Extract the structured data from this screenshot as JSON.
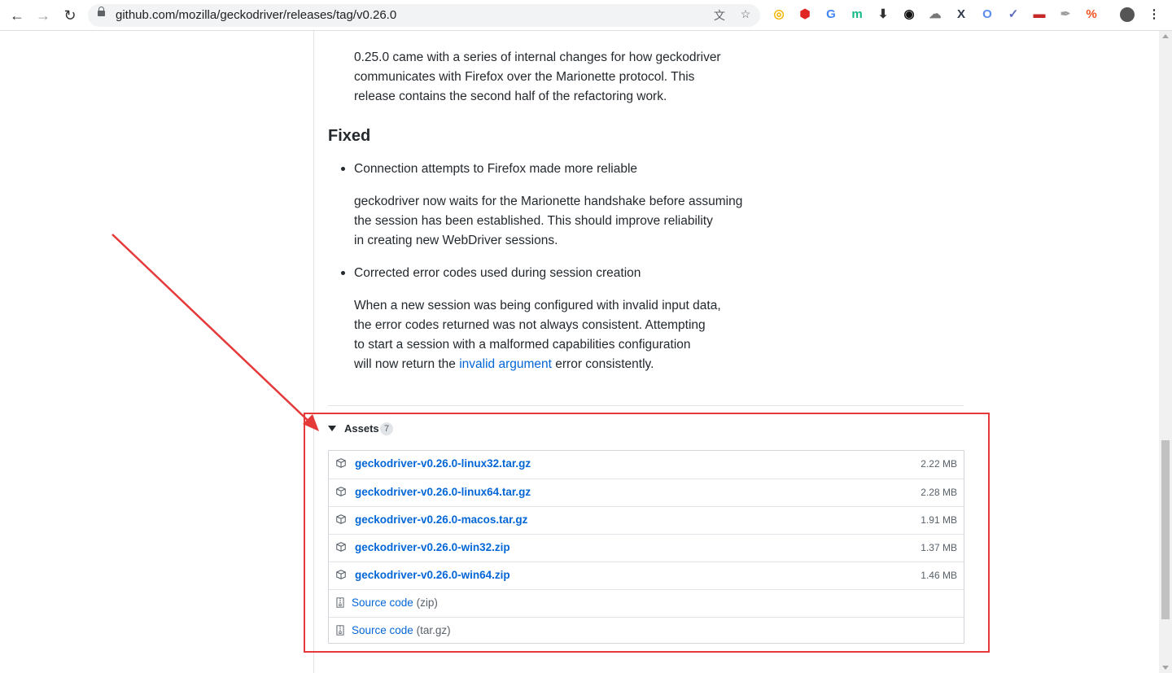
{
  "browser": {
    "url": "github.com/mozilla/geckodriver/releases/tag/v0.26.0",
    "extensions": [
      {
        "name": "chrome-ext-icon",
        "color": "#f4b400"
      },
      {
        "name": "adblock-icon",
        "color": "#e02424"
      },
      {
        "name": "google-translate-icon",
        "color": "#4285f4"
      },
      {
        "name": "m-ext-icon",
        "color": "#12b886"
      },
      {
        "name": "download-icon",
        "color": "#333333"
      },
      {
        "name": "eye-icon",
        "color": "#111111"
      },
      {
        "name": "cloud-icon",
        "color": "#777777"
      },
      {
        "name": "x-ext-icon",
        "color": "#2d3748"
      },
      {
        "name": "o-ext-icon",
        "color": "#5b8def"
      },
      {
        "name": "check-ext-icon",
        "color": "#5c6bc0"
      },
      {
        "name": "mask-ext-icon",
        "color": "#c62828"
      },
      {
        "name": "feather-ext-icon",
        "color": "#9e9e9e"
      },
      {
        "name": "percent-ext-icon",
        "color": "#f4511e"
      }
    ]
  },
  "content": {
    "para_refactor": [
      "0.25.0 came with a series of internal changes for how geckodriver",
      "communicates with Firefox over the Marionette protocol. This",
      "release contains the second half of the refactoring work."
    ],
    "fixed_heading": "Fixed",
    "fixed_items": [
      {
        "title": "Connection attempts to Firefox made more reliable",
        "body": [
          "geckodriver now waits for the Marionette handshake before assuming",
          "the session has been established. This should improve reliability",
          "in creating new WebDriver sessions."
        ]
      },
      {
        "title": "Corrected error codes used during session creation",
        "body": [
          "When a new session was being configured with invalid input data,",
          "the error codes returned was not always consistent. Attempting",
          "to start a session with a malformed capabilities configuration"
        ],
        "last_line_prefix": "will now return the ",
        "last_line_link": "invalid argument",
        "last_line_suffix": " error consistently."
      }
    ]
  },
  "assets": {
    "label": "Assets",
    "count": "7",
    "files": [
      {
        "name": "geckodriver-v0.26.0-linux32.tar.gz",
        "size": "2.22 MB"
      },
      {
        "name": "geckodriver-v0.26.0-linux64.tar.gz",
        "size": "2.28 MB"
      },
      {
        "name": "geckodriver-v0.26.0-macos.tar.gz",
        "size": "1.91 MB"
      },
      {
        "name": "geckodriver-v0.26.0-win32.zip",
        "size": "1.37 MB"
      },
      {
        "name": "geckodriver-v0.26.0-win64.zip",
        "size": "1.46 MB"
      }
    ],
    "sources": [
      {
        "name": "Source code",
        "ext": "(zip)"
      },
      {
        "name": "Source code",
        "ext": "(tar.gz)"
      }
    ]
  },
  "annotation_color": "#e5393a"
}
